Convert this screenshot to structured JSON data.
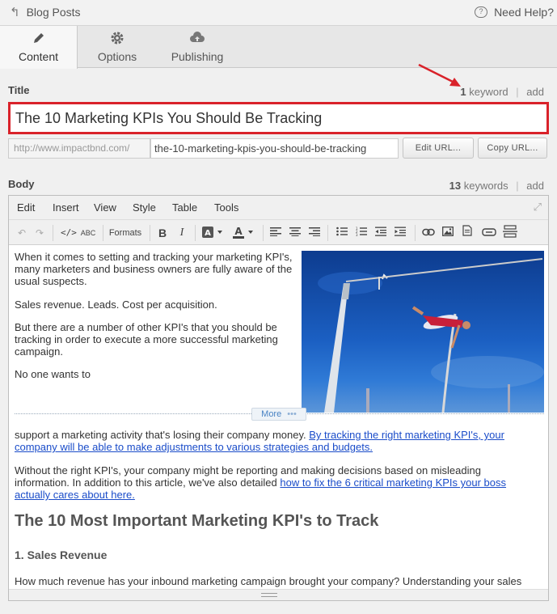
{
  "topbar": {
    "back_label": "Blog Posts",
    "help_label": "Need Help?"
  },
  "tabs": [
    {
      "label": "Content",
      "icon": "pencil-icon",
      "active": true
    },
    {
      "label": "Options",
      "icon": "gear-icon",
      "active": false
    },
    {
      "label": "Publishing",
      "icon": "cloud-upload-icon",
      "active": false
    }
  ],
  "title_section": {
    "label": "Title",
    "keyword_count": "1",
    "keyword_label": "keyword",
    "add_label": "add",
    "title_value": "The 10 Marketing KPIs You Should Be Tracking",
    "highlight_color": "#d9222a",
    "url_prefix": "http://www.impactbnd.com/",
    "url_slug": "the-10-marketing-kpis-you-should-be-tracking",
    "edit_url_label": "Edit URL...",
    "copy_url_label": "Copy URL..."
  },
  "body_section": {
    "label": "Body",
    "keyword_count": "13",
    "keyword_label": "keywords",
    "add_label": "add"
  },
  "editor": {
    "menu": [
      "Edit",
      "Insert",
      "View",
      "Style",
      "Table",
      "Tools"
    ],
    "formats_label": "Formats",
    "more_label": "More",
    "paragraphs": {
      "p1_line1": "When it comes to setting and tracking your marketing KPI's,",
      "p1_line2": "many marketers and business owners are fully aware of the",
      "p1_line3": "usual suspects.",
      "p2": "Sales revenue. Leads. Cost per acquisition.",
      "p3_line1": "But there are a number of other KPI's that you should be",
      "p3_line2": "tracking in order to execute a more successful marketing",
      "p3_line3": "campaign.",
      "p4": "No one wants to",
      "p5_text": "support a marketing activity that's losing their company money.",
      "p5_link_line1": "By tracking the right marketing KPI's, your",
      "p5_link_line2": "company will be able to make adjustments to various strategies and budgets.",
      "p6_line1": "Without the right KPI's, your company might be reporting and making decisions based on misleading",
      "p6_line2_text": "information. In addition to this article, we've also detailed",
      "p6_link_line1": "how to fix the 6 critical marketing KPIs your boss",
      "p6_link_line2": "actually cares about here.",
      "h2": "The 10 Most Important Marketing KPI's to Track",
      "h3": "1. Sales Revenue",
      "p7": "How much revenue has your inbound marketing campaign brought your company? Understanding your sales"
    }
  },
  "annotation": {
    "arrow_color": "#d9222a"
  }
}
